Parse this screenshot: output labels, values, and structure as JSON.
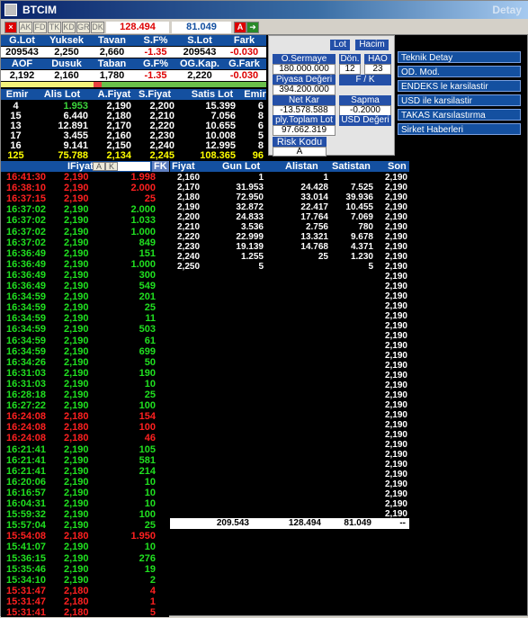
{
  "window": {
    "title": "BTCIM",
    "right_label": "Detay"
  },
  "toolbar": {
    "buttons": [
      "AK",
      "FD",
      "TK",
      "KD",
      "GR",
      "DK"
    ],
    "v1": "128.494",
    "v2": "81.049",
    "mode": "A"
  },
  "summary": {
    "head1": [
      "G.Lot",
      "Yuksek",
      "Tavan",
      "S.F%",
      "S.Lot",
      "Fark"
    ],
    "row1": [
      "209543",
      "2,250",
      "2,660",
      "-1.35",
      "209543",
      "-0.030"
    ],
    "head2": [
      "AOF",
      "Dusuk",
      "Taban",
      "G.F%",
      "OG.Kap.",
      "G.Fark"
    ],
    "row2": [
      "2,192",
      "2,160",
      "1,780",
      "-1.35",
      "2,220",
      "-0.030"
    ]
  },
  "right_panel": {
    "lot": "Lot",
    "hacim": "Hacim",
    "o_sermaye": "O.Sermaye",
    "o_sermaye_val": "180.000.000",
    "don": "Dön.",
    "don_val": "12",
    "hao": "HAO",
    "hao_val": "23",
    "piyasa": "Piyasa Değeri",
    "piyasa_val": "394.200.000",
    "fk": "F / K",
    "net_kar": "Net Kar",
    "net_kar_val": "-13.578.588",
    "sapma": "Sapma",
    "sapma_val": "-0.2000",
    "ply": "ply.Toplam Lot",
    "ply_val": "97.662.319",
    "usd": "USD Değeri",
    "risk": "Risk Kodu",
    "risk_val": "A"
  },
  "links": [
    "Teknik Detay",
    "OD. Mod.",
    "ENDEKS le karsilastir",
    "USD ile karsilastir",
    "TAKAS Karsılastırma",
    "Sirket Haberleri"
  ],
  "depth": {
    "headers": [
      "Emir",
      "Alis Lot",
      "A.Fiyat",
      "S.Fiyat",
      "Satis Lot",
      "Emir"
    ],
    "rows": [
      [
        "4",
        "1.953",
        "2,190",
        "2,200",
        "15.399",
        "6"
      ],
      [
        "15",
        "6.440",
        "2,180",
        "2,210",
        "7.056",
        "8"
      ],
      [
        "13",
        "12.891",
        "2,170",
        "2,220",
        "10.655",
        "6"
      ],
      [
        "17",
        "3.455",
        "2,160",
        "2,230",
        "10.008",
        "5"
      ],
      [
        "16",
        "9.141",
        "2,150",
        "2,240",
        "12.995",
        "8"
      ]
    ],
    "total": [
      "125",
      "75.788",
      "2,134",
      "2,245",
      "108.365",
      "96"
    ]
  },
  "trades_header": {
    "fiyat": "IFiyat",
    "a": "A",
    "k": "K",
    "fk": "FK"
  },
  "trades": [
    [
      "16:41:30",
      "2,190",
      "1.998",
      "r"
    ],
    [
      "16:38:10",
      "2,190",
      "2.000",
      "r"
    ],
    [
      "16:37:15",
      "2,190",
      "25",
      "r"
    ],
    [
      "16:37:02",
      "2,190",
      "2.000",
      "g"
    ],
    [
      "16:37:02",
      "2,190",
      "1.033",
      "g"
    ],
    [
      "16:37:02",
      "2,190",
      "1.000",
      "g"
    ],
    [
      "16:37:02",
      "2,190",
      "849",
      "g"
    ],
    [
      "16:36:49",
      "2,190",
      "151",
      "g"
    ],
    [
      "16:36:49",
      "2,190",
      "1.000",
      "g"
    ],
    [
      "16:36:49",
      "2,190",
      "300",
      "g"
    ],
    [
      "16:36:49",
      "2,190",
      "549",
      "g"
    ],
    [
      "16:34:59",
      "2,190",
      "201",
      "g"
    ],
    [
      "16:34:59",
      "2,190",
      "25",
      "g"
    ],
    [
      "16:34:59",
      "2,190",
      "11",
      "g"
    ],
    [
      "16:34:59",
      "2,190",
      "503",
      "g"
    ],
    [
      "16:34:59",
      "2,190",
      "61",
      "g"
    ],
    [
      "16:34:59",
      "2,190",
      "699",
      "g"
    ],
    [
      "16:34:26",
      "2,190",
      "50",
      "g"
    ],
    [
      "16:31:03",
      "2,190",
      "190",
      "g"
    ],
    [
      "16:31:03",
      "2,190",
      "10",
      "g"
    ],
    [
      "16:28:18",
      "2,190",
      "25",
      "g"
    ],
    [
      "16:27:22",
      "2,190",
      "100",
      "g"
    ],
    [
      "16:24:08",
      "2,180",
      "154",
      "r"
    ],
    [
      "16:24:08",
      "2,180",
      "100",
      "r"
    ],
    [
      "16:24:08",
      "2,180",
      "46",
      "r"
    ],
    [
      "16:21:41",
      "2,190",
      "105",
      "g"
    ],
    [
      "16:21:41",
      "2,190",
      "581",
      "g"
    ],
    [
      "16:21:41",
      "2,190",
      "214",
      "g"
    ],
    [
      "16:20:06",
      "2,190",
      "10",
      "g"
    ],
    [
      "16:16:57",
      "2,190",
      "10",
      "g"
    ],
    [
      "16:04:31",
      "2,190",
      "10",
      "g"
    ],
    [
      "15:59:32",
      "2,190",
      "100",
      "g"
    ],
    [
      "15:57:04",
      "2,190",
      "25",
      "g"
    ],
    [
      "15:54:08",
      "2,180",
      "1.950",
      "r"
    ],
    [
      "15:41:07",
      "2,190",
      "10",
      "g"
    ],
    [
      "15:36:15",
      "2,190",
      "276",
      "g"
    ],
    [
      "15:35:46",
      "2,190",
      "19",
      "g"
    ],
    [
      "15:34:10",
      "2,190",
      "2",
      "g"
    ],
    [
      "15:31:47",
      "2,180",
      "4",
      "r"
    ],
    [
      "15:31:47",
      "2,180",
      "1",
      "r"
    ],
    [
      "15:31:41",
      "2,180",
      "5",
      "r"
    ]
  ],
  "book": {
    "headers": [
      "Fiyat",
      "Gun Lot",
      "Alistan",
      "Satistan",
      "Son"
    ],
    "rows": [
      [
        "2,160",
        "1",
        "1",
        "",
        ""
      ],
      [
        "2,170",
        "31.953",
        "24.428",
        "7.525",
        ""
      ],
      [
        "2,180",
        "72.950",
        "33.014",
        "39.936",
        ""
      ],
      [
        "2,190",
        "32.872",
        "22.417",
        "10.455",
        ""
      ],
      [
        "2,200",
        "24.833",
        "17.764",
        "7.069",
        ""
      ],
      [
        "2,210",
        "3.536",
        "2.756",
        "780",
        ""
      ],
      [
        "2,220",
        "22.999",
        "13.321",
        "9.678",
        ""
      ],
      [
        "2,230",
        "19.139",
        "14.768",
        "4.371",
        ""
      ],
      [
        "2,240",
        "1.255",
        "25",
        "1.230",
        ""
      ],
      [
        "2,250",
        "5",
        "",
        "5",
        ""
      ]
    ],
    "son_value": "2,190",
    "son_count": 35,
    "totals": [
      "209.543",
      "128.494",
      "81.049",
      "--"
    ]
  }
}
